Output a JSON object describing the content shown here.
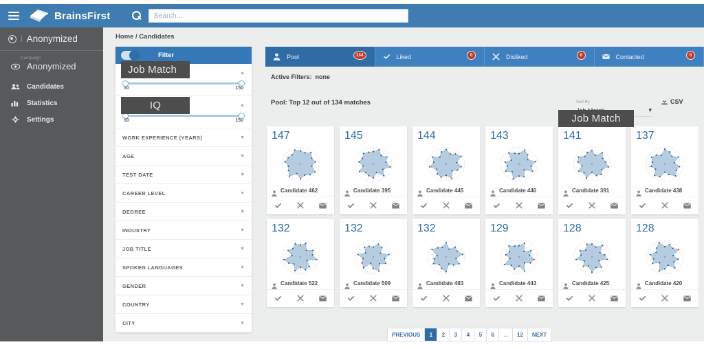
{
  "topbar": {
    "menu_icon": "hamburger-icon",
    "brand": "BrainsFirst",
    "search_icon": "search-icon",
    "search_placeholder": "Search...",
    "search_value": ""
  },
  "sidebar": {
    "header_title": "Anonymized",
    "header_divider": "|",
    "campaign_label": "Campaign",
    "items": [
      {
        "label": "Anonymized",
        "icon": "eye-icon"
      },
      {
        "label": "Candidates",
        "icon": "users-icon"
      },
      {
        "label": "Statistics",
        "icon": "chart-icon"
      },
      {
        "label": "Settings",
        "icon": "gear-icon"
      }
    ]
  },
  "breadcrumb": "Home / Candidates",
  "filter_panel": {
    "header_title": "Filter",
    "toggle_on": true,
    "sections": [
      {
        "title": "JOB MATCH",
        "expanded": true,
        "min": "50",
        "max": "150"
      },
      {
        "title": "IQ",
        "expanded": true,
        "min": "50",
        "max": "150"
      },
      {
        "title": "WORK EXPERIENCE (YEARS)",
        "expanded": false
      },
      {
        "title": "AGE",
        "expanded": false
      },
      {
        "title": "TEST DATE",
        "expanded": false
      },
      {
        "title": "CAREER LEVEL",
        "expanded": false
      },
      {
        "title": "DEGREE",
        "expanded": false
      },
      {
        "title": "INDUSTRY",
        "expanded": false
      },
      {
        "title": "JOB TITLE",
        "expanded": false
      },
      {
        "title": "SPOKEN LANGUAGES",
        "expanded": false
      },
      {
        "title": "GENDER",
        "expanded": false
      },
      {
        "title": "COUNTRY",
        "expanded": false
      },
      {
        "title": "CITY",
        "expanded": false
      }
    ]
  },
  "tooltips": {
    "job_match": "Job Match",
    "iq": "IQ",
    "sort_by": "Job Match"
  },
  "tabs": [
    {
      "label": "Pool",
      "count": "134",
      "icon": "person-icon",
      "active": true
    },
    {
      "label": "Liked",
      "count": "0",
      "icon": "check-icon",
      "active": false
    },
    {
      "label": "Disliked",
      "count": "0",
      "icon": "cross-icon",
      "active": false
    },
    {
      "label": "Contacted",
      "count": "0",
      "icon": "envelope-icon",
      "active": false
    }
  ],
  "main": {
    "active_filters_label": "Active Filters:",
    "active_filters_value": "none",
    "pool_title": "Pool: Top 12 out of 134 matches",
    "sort_by_label": "Sort By",
    "sort_by_value": "Job Match",
    "sort_caret": "▾",
    "csv_label": "CSV",
    "csv_icon": "download-icon"
  },
  "cards": [
    {
      "score": "147",
      "name": "Candidate 462",
      "radar": [
        0.78,
        0.72,
        0.88,
        0.7,
        0.82,
        0.62,
        0.9,
        0.8,
        0.68,
        0.85,
        0.58,
        0.92,
        0.74,
        0.66,
        0.84,
        0.76,
        0.7,
        0.88
      ]
    },
    {
      "score": "145",
      "name": "Candidate 395",
      "radar": [
        0.74,
        0.9,
        0.66,
        0.84,
        0.7,
        0.92,
        0.6,
        0.88,
        0.52,
        0.8,
        0.72,
        0.64,
        0.86,
        0.56,
        0.78,
        0.68,
        0.82,
        0.74
      ]
    },
    {
      "score": "144",
      "name": "Candidate 445",
      "radar": [
        0.86,
        0.64,
        0.78,
        0.92,
        0.58,
        0.82,
        0.7,
        0.5,
        0.88,
        0.66,
        0.8,
        0.74,
        0.6,
        0.9,
        0.68,
        0.84,
        0.54,
        0.76
      ]
    },
    {
      "score": "143",
      "name": "Candidate 440",
      "radar": [
        0.62,
        0.88,
        0.72,
        0.54,
        0.9,
        0.66,
        0.84,
        0.44,
        0.78,
        0.7,
        0.92,
        0.58,
        0.82,
        0.64,
        0.76,
        0.48,
        0.86,
        0.68
      ]
    },
    {
      "score": "141",
      "name": "Candidate 391",
      "radar": [
        0.8,
        0.56,
        0.86,
        0.68,
        0.74,
        0.9,
        0.62,
        0.78,
        0.7,
        0.48,
        0.88,
        0.66,
        0.82,
        0.54,
        0.76,
        0.84,
        0.6,
        0.72
      ]
    },
    {
      "score": "137",
      "name": "Candidate 438",
      "radar": [
        0.88,
        0.76,
        0.6,
        0.84,
        0.52,
        0.8,
        0.72,
        0.9,
        0.64,
        0.46,
        0.78,
        0.86,
        0.58,
        0.74,
        0.68,
        0.82,
        0.7,
        0.56
      ]
    },
    {
      "score": "132",
      "name": "Candidate 522",
      "radar": [
        0.7,
        0.84,
        0.5,
        0.78,
        0.66,
        0.88,
        0.42,
        0.74,
        0.8,
        0.6,
        0.86,
        0.54,
        0.72,
        0.9,
        0.46,
        0.76,
        0.64,
        0.82
      ]
    },
    {
      "score": "132",
      "name": "Candidate 509",
      "radar": [
        0.58,
        0.8,
        0.72,
        0.44,
        0.86,
        0.62,
        0.76,
        0.52,
        0.88,
        0.68,
        0.4,
        0.82,
        0.7,
        0.56,
        0.84,
        0.48,
        0.74,
        0.66
      ]
    },
    {
      "score": "132",
      "name": "Candidate 483",
      "radar": [
        0.84,
        0.48,
        0.76,
        0.68,
        0.9,
        0.54,
        0.8,
        0.62,
        0.44,
        0.86,
        0.72,
        0.58,
        0.78,
        0.66,
        0.5,
        0.88,
        0.7,
        0.6
      ]
    },
    {
      "score": "129",
      "name": "Candidate 443",
      "radar": [
        0.66,
        0.86,
        0.42,
        0.74,
        0.58,
        0.82,
        0.7,
        0.46,
        0.88,
        0.54,
        0.76,
        0.64,
        0.9,
        0.5,
        0.72,
        0.6,
        0.84,
        0.68
      ]
    },
    {
      "score": "128",
      "name": "Candidate 425",
      "radar": [
        0.76,
        0.62,
        0.88,
        0.5,
        0.7,
        0.84,
        0.44,
        0.78,
        0.66,
        0.9,
        0.56,
        0.72,
        0.48,
        0.86,
        0.6,
        0.74,
        0.52,
        0.8
      ]
    },
    {
      "score": "128",
      "name": "Candidate 420",
      "radar": [
        0.6,
        0.78,
        0.66,
        0.86,
        0.46,
        0.72,
        0.58,
        0.84,
        0.52,
        0.7,
        0.88,
        0.44,
        0.76,
        0.62,
        0.8,
        0.54,
        0.68,
        0.9
      ]
    }
  ],
  "card_actions": [
    {
      "icon": "check-icon",
      "name": "like-button"
    },
    {
      "icon": "cross-icon",
      "name": "dislike-button"
    },
    {
      "icon": "envelope-icon",
      "name": "contact-button"
    }
  ],
  "pagination": {
    "previous": "PREVIOUS",
    "next": "NEXT",
    "pages": [
      "1",
      "2",
      "3",
      "4",
      "5",
      "6",
      "...",
      "12"
    ],
    "current": "1"
  },
  "colors": {
    "brand_blue": "#3e7cb1",
    "tab_active": "#2f6ba5",
    "tab_inactive": "#3f81c0",
    "badge_red": "#c0392b",
    "sidebar_gray": "#58595b",
    "radar_fill": "#a9c3db",
    "radar_dot": "#3b5f87",
    "score_blue": "#2f6ba5"
  }
}
